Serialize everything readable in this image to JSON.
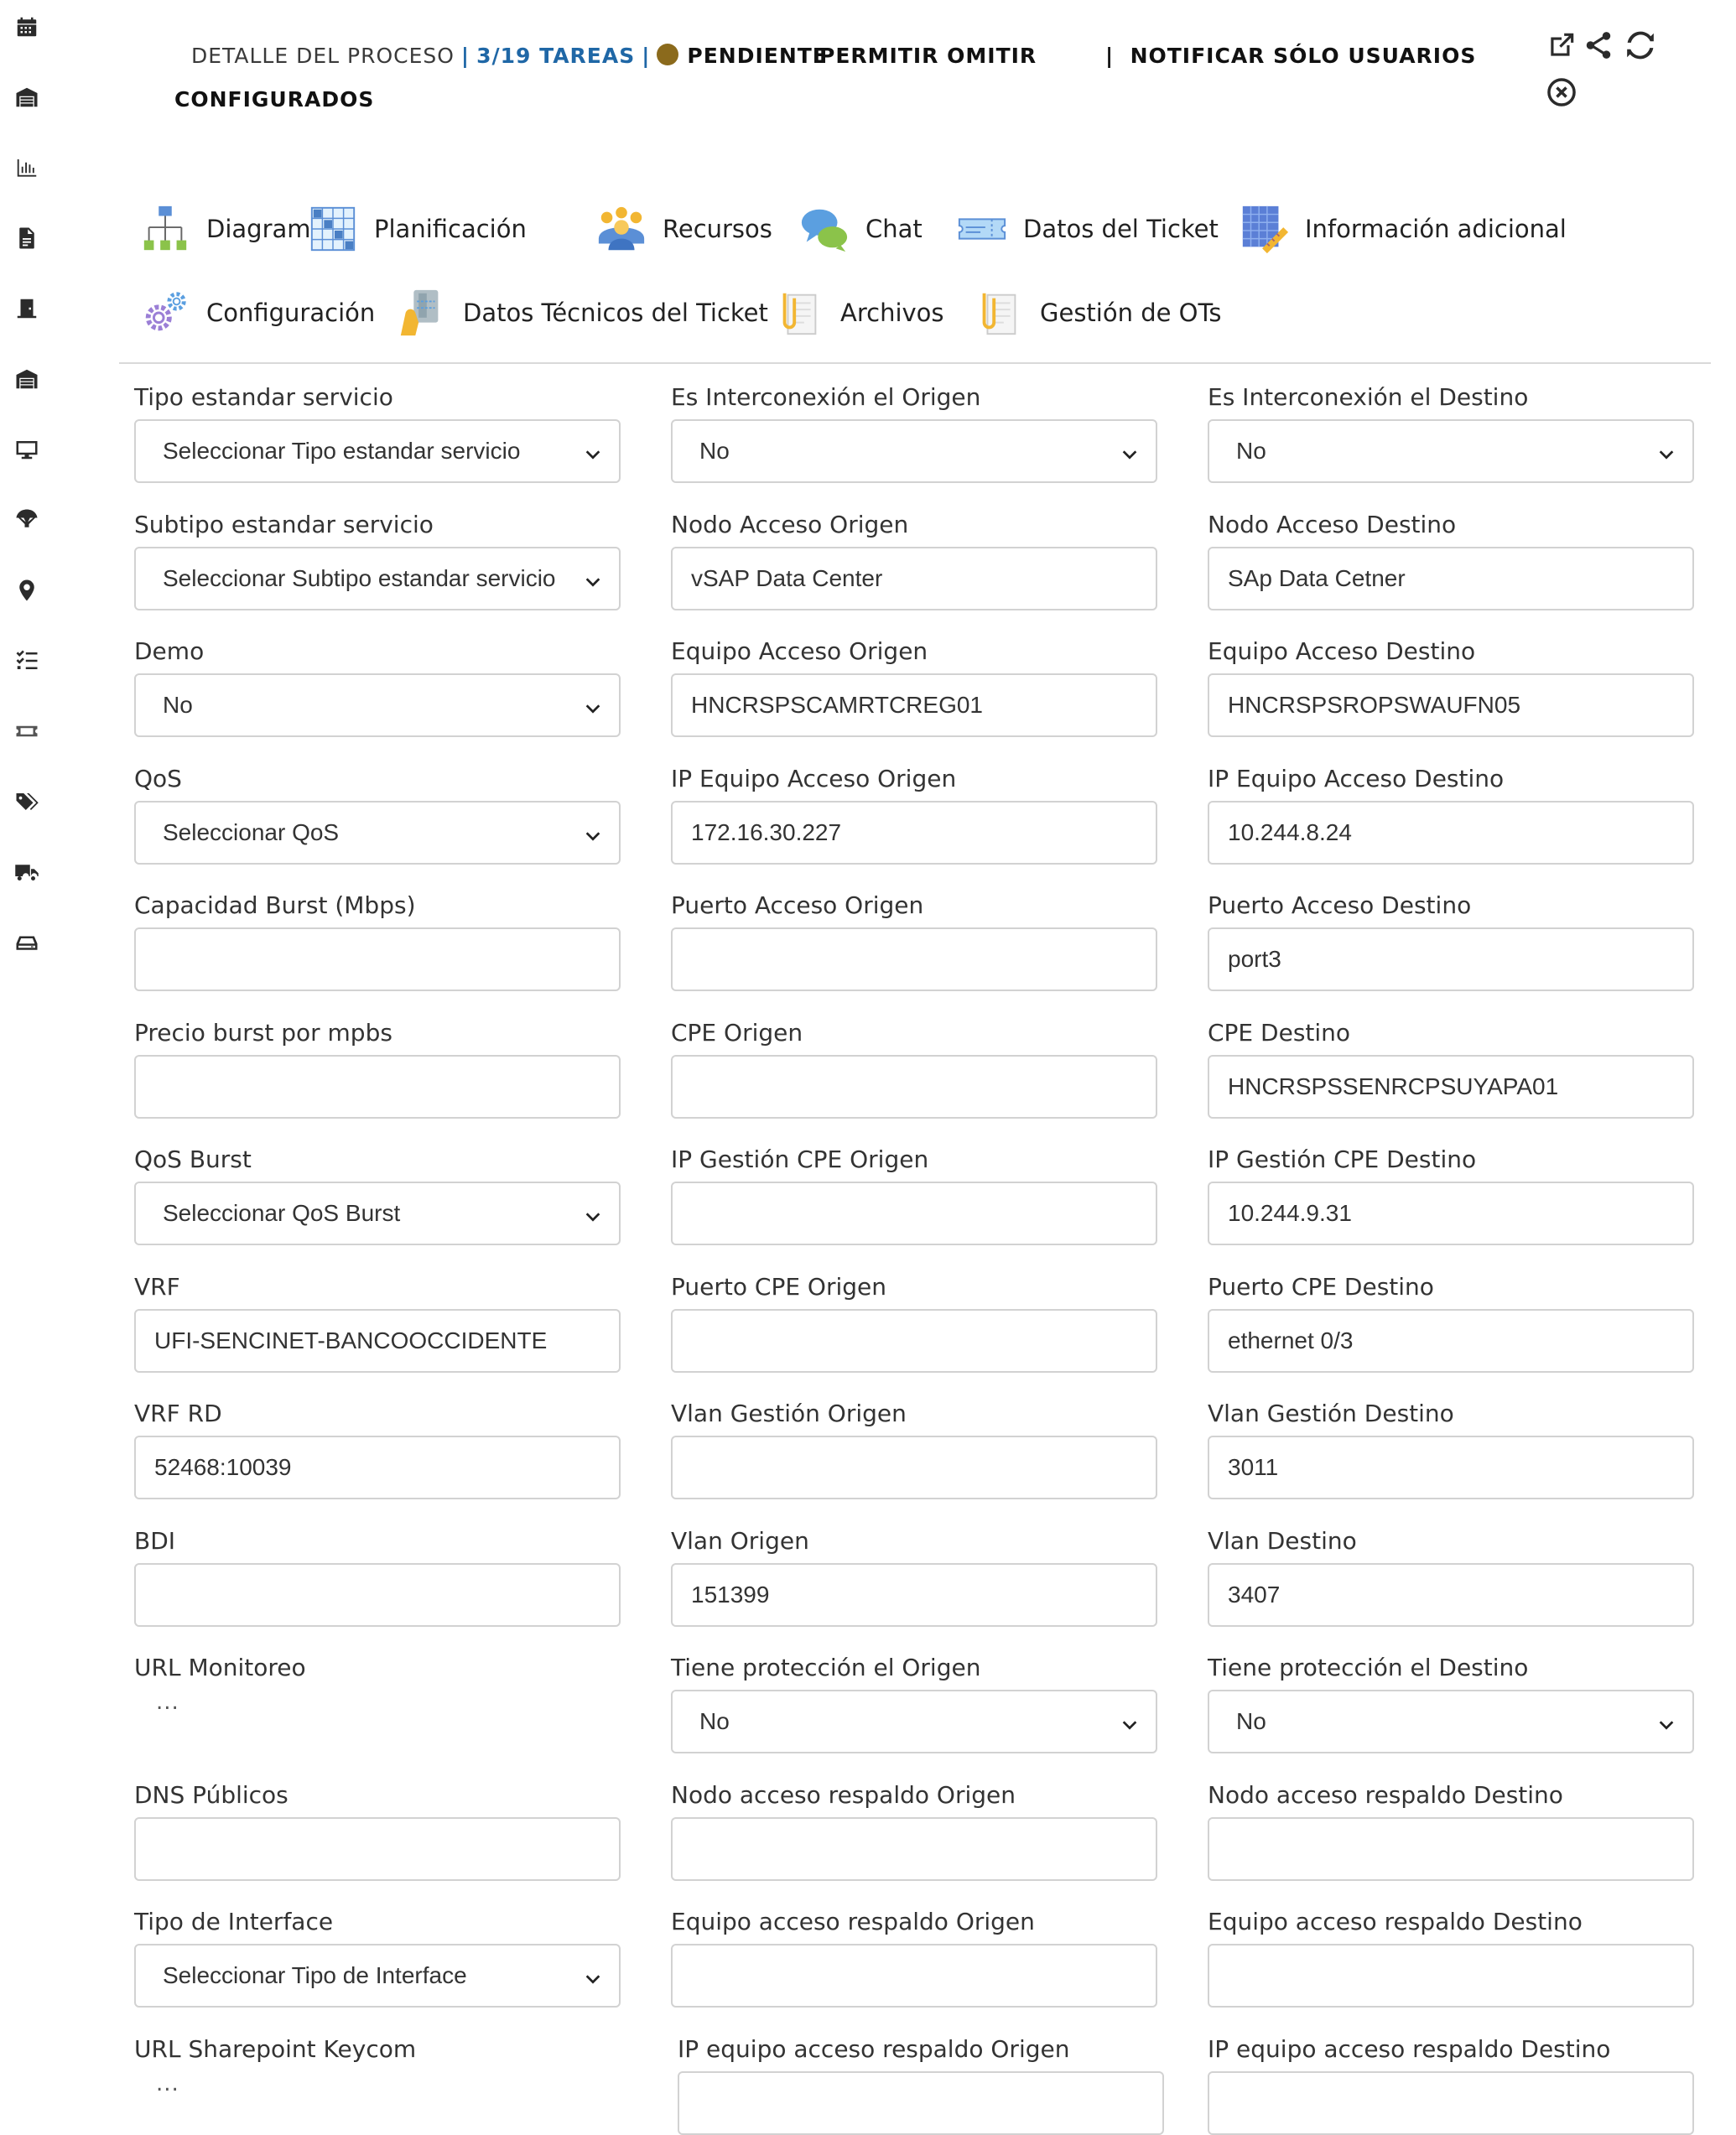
{
  "header": {
    "title": "DETALLE DEL PROCESO",
    "tasks": "3/19 TAREAS",
    "status": "PENDIENTE",
    "status_color": "#8b6a1c",
    "allow_skip": "PERMITIR OMITIR",
    "notify_line1": "NOTIFICAR SÓLO USUARIOS",
    "notify_line2": "CONFIGURADOS"
  },
  "header_actions": [
    "external-link-icon",
    "share-icon",
    "refresh-icon",
    "close-circle-icon"
  ],
  "sidebar": {
    "items": [
      {
        "icon": "calendar-icon"
      },
      {
        "icon": "warehouse-icon"
      },
      {
        "icon": "bar-chart-icon"
      },
      {
        "icon": "document-icon"
      },
      {
        "icon": "door-icon"
      },
      {
        "icon": "warehouse-icon"
      },
      {
        "icon": "monitor-icon"
      },
      {
        "icon": "parachute-icon"
      },
      {
        "icon": "map-marker-icon"
      },
      {
        "icon": "task-list-icon"
      },
      {
        "icon": "ticket-icon"
      },
      {
        "icon": "tags-icon"
      },
      {
        "icon": "truck-icon"
      },
      {
        "icon": "hard-drive-icon"
      }
    ]
  },
  "tabs": [
    {
      "label": "Diagrama",
      "icon": "diagram-icon"
    },
    {
      "label": "Planificación",
      "icon": "planning-icon"
    },
    {
      "label": "Recursos",
      "icon": "resources-icon"
    },
    {
      "label": "Chat",
      "icon": "chat-icon"
    },
    {
      "label": "Datos del Ticket",
      "icon": "ticket-data-icon"
    },
    {
      "label": "Información adicional",
      "icon": "additional-info-icon"
    },
    {
      "label": "Configuración",
      "icon": "settings-gears-icon"
    },
    {
      "label": "Datos Técnicos del Ticket",
      "icon": "technical-data-icon"
    },
    {
      "label": "Archivos",
      "icon": "files-icon"
    },
    {
      "label": "Gestión de OTs",
      "icon": "work-orders-icon"
    }
  ],
  "form": {
    "col1": [
      {
        "label": "Tipo estandar servicio",
        "type": "select",
        "value": "Seleccionar Tipo estandar servicio"
      },
      {
        "label": "Subtipo estandar servicio",
        "type": "select",
        "value": "Seleccionar Subtipo estandar servicio"
      },
      {
        "label": "Demo",
        "type": "select",
        "value": "No"
      },
      {
        "label": "QoS",
        "type": "select",
        "value": "Seleccionar QoS"
      },
      {
        "label": "Capacidad Burst (Mbps)",
        "type": "input",
        "value": ""
      },
      {
        "label": "Precio burst por mpbs",
        "type": "input",
        "value": ""
      },
      {
        "label": "QoS Burst",
        "type": "select",
        "value": "Seleccionar QoS Burst"
      },
      {
        "label": "VRF",
        "type": "input",
        "value": "UFI-SENCINET-BANCOOCCIDENTE"
      },
      {
        "label": "VRF RD",
        "type": "input",
        "value": "52468:10039"
      },
      {
        "label": "BDI",
        "type": "input",
        "value": ""
      },
      {
        "label": "URL Monitoreo",
        "type": "link",
        "value": "..."
      },
      {
        "label": "DNS Públicos",
        "type": "input",
        "value": ""
      },
      {
        "label": "Tipo de Interface",
        "type": "select",
        "value": "Seleccionar Tipo de Interface"
      },
      {
        "label": "URL Sharepoint Keycom",
        "type": "link",
        "value": "..."
      }
    ],
    "col2": [
      {
        "label": "Es Interconexión el Origen",
        "type": "select",
        "value": "No"
      },
      {
        "label": "Nodo Acceso Origen",
        "type": "input",
        "value": "vSAP Data Center"
      },
      {
        "label": "Equipo Acceso Origen",
        "type": "input",
        "value": "HNCRSPSCAMRTCREG01"
      },
      {
        "label": "IP Equipo Acceso Origen",
        "type": "input",
        "value": "172.16.30.227"
      },
      {
        "label": "Puerto Acceso Origen",
        "type": "input",
        "value": ""
      },
      {
        "label": "CPE Origen",
        "type": "input",
        "value": ""
      },
      {
        "label": "IP Gestión CPE Origen",
        "type": "input",
        "value": ""
      },
      {
        "label": "Puerto CPE Origen",
        "type": "input",
        "value": ""
      },
      {
        "label": "Vlan Gestión Origen",
        "type": "input",
        "value": ""
      },
      {
        "label": "Vlan Origen",
        "type": "input",
        "value": "151399"
      },
      {
        "label": "Tiene protección el Origen",
        "type": "select",
        "value": "No"
      },
      {
        "label": "Nodo acceso respaldo Origen",
        "type": "input",
        "value": ""
      },
      {
        "label": "Equipo acceso respaldo Origen",
        "type": "input",
        "value": ""
      },
      {
        "label": "IP equipo acceso respaldo Origen",
        "type": "input",
        "value": ""
      }
    ],
    "col3": [
      {
        "label": "Es Interconexión el Destino",
        "type": "select",
        "value": "No"
      },
      {
        "label": "Nodo Acceso Destino",
        "type": "input",
        "value": "SAp Data Cetner"
      },
      {
        "label": "Equipo Acceso Destino",
        "type": "input",
        "value": "HNCRSPSROPSWAUFN05"
      },
      {
        "label": "IP Equipo Acceso Destino",
        "type": "input",
        "value": "10.244.8.24"
      },
      {
        "label": "Puerto Acceso Destino",
        "type": "input",
        "value": "port3"
      },
      {
        "label": "CPE Destino",
        "type": "input",
        "value": "HNCRSPSSENRCPSUYAPA01"
      },
      {
        "label": "IP Gestión CPE Destino",
        "type": "input",
        "value": "10.244.9.31"
      },
      {
        "label": "Puerto CPE Destino",
        "type": "input",
        "value": "ethernet 0/3"
      },
      {
        "label": "Vlan Gestión Destino",
        "type": "input",
        "value": "3011"
      },
      {
        "label": "Vlan Destino",
        "type": "input",
        "value": "3407"
      },
      {
        "label": "Tiene protección el Destino",
        "type": "select",
        "value": "No"
      },
      {
        "label": "Nodo acceso respaldo Destino",
        "type": "input",
        "value": ""
      },
      {
        "label": "Equipo acceso respaldo Destino",
        "type": "input",
        "value": ""
      },
      {
        "label": "IP equipo acceso respaldo Destino",
        "type": "input",
        "value": ""
      }
    ]
  }
}
